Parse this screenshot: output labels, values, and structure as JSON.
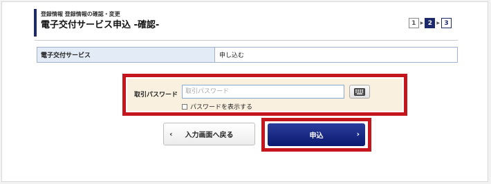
{
  "header": {
    "breadcrumb": "登録情報 登録情報の確認・変更",
    "title": "電子交付サービス申込 -確認-"
  },
  "steps": {
    "items": [
      "1",
      "2",
      "3"
    ],
    "active": "2"
  },
  "info_table": {
    "key": "電子交付サービス",
    "value": "申し込む"
  },
  "password": {
    "label": "取引パスワード",
    "placeholder": "取引パスワード",
    "show_checkbox_label": "パスワードを表示する",
    "keyboard_icon": "keyboard-icon"
  },
  "buttons": {
    "back_label": "入力画面へ戻る",
    "apply_label": "申込"
  },
  "colors": {
    "accent_navy": "#1c2a6b",
    "highlight_red": "#c4161c",
    "table_key_bg": "#e3ebf7",
    "password_bg": "#faf0df"
  }
}
